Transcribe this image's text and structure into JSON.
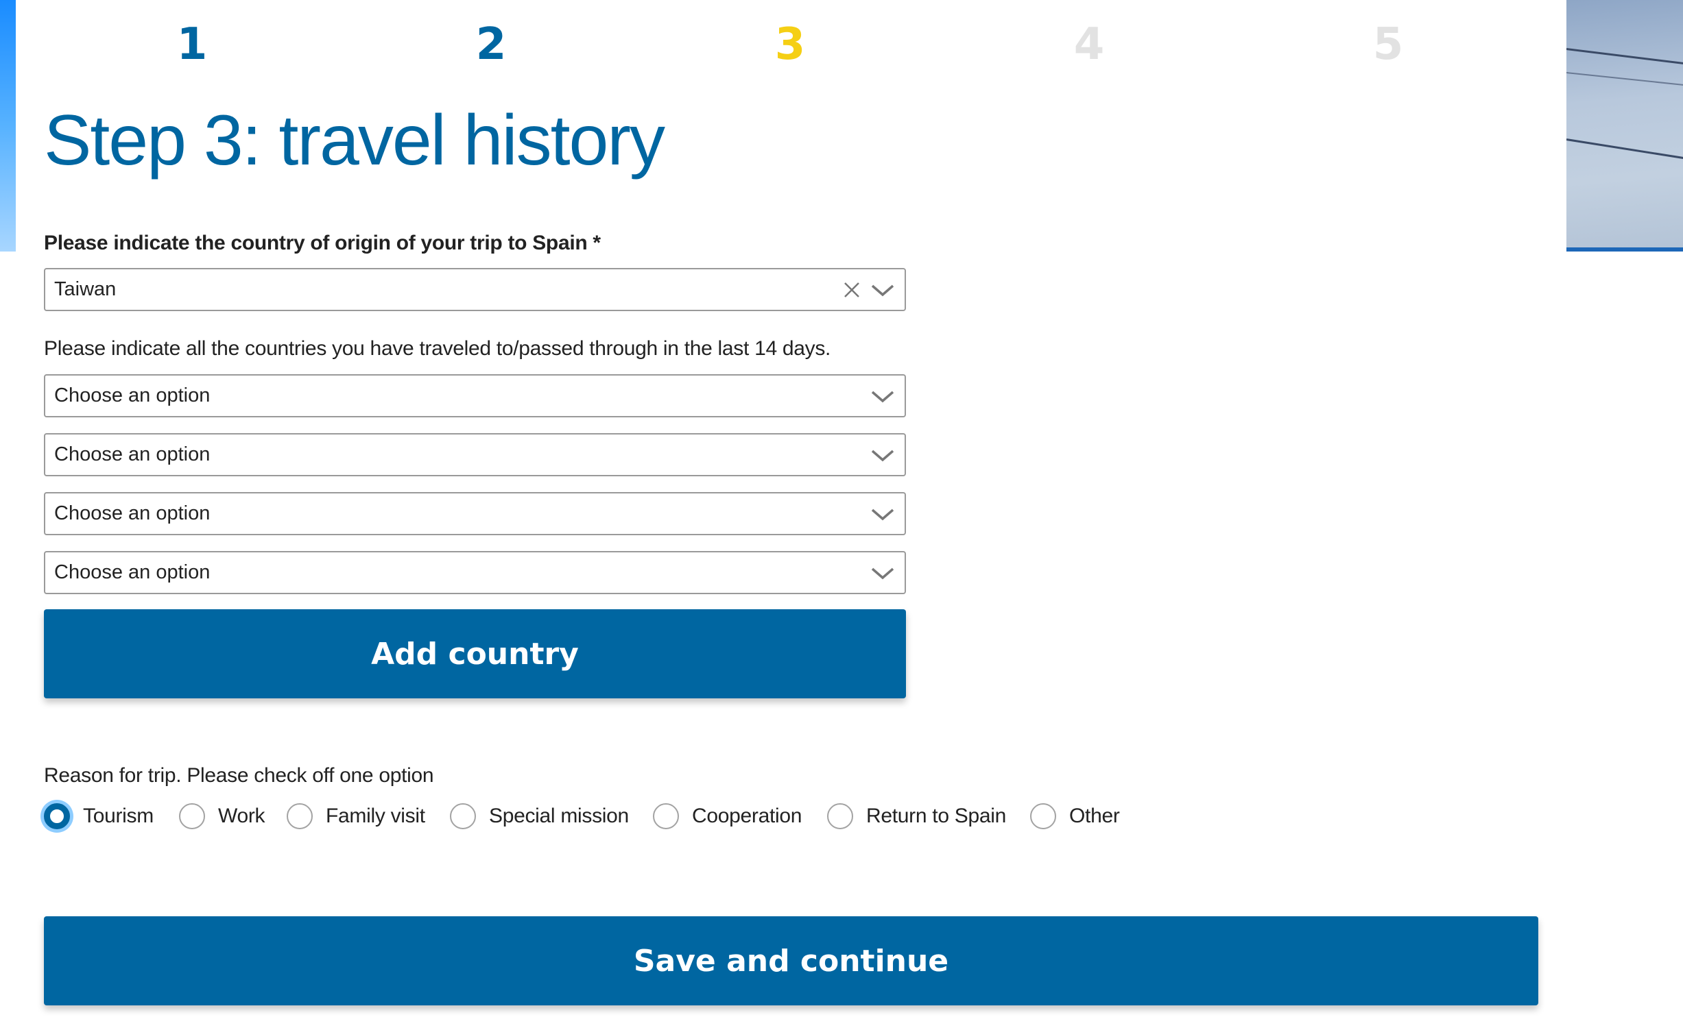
{
  "progress": {
    "steps": [
      {
        "number": "1",
        "state": "done"
      },
      {
        "number": "2",
        "state": "done"
      },
      {
        "number": "3",
        "state": "current"
      },
      {
        "number": "4",
        "state": "todo"
      },
      {
        "number": "5",
        "state": "todo"
      }
    ],
    "current_step": 3,
    "total_steps": 5
  },
  "page": {
    "title": "Step 3: travel history"
  },
  "origin": {
    "label": "Please indicate the country of origin of your trip to Spain *",
    "value": "Taiwan",
    "clear_icon": "close-icon",
    "dropdown_icon": "chevron-down-icon"
  },
  "transit": {
    "label": "Please indicate all the countries you have traveled to/passed through in the last 14 days.",
    "selects": [
      {
        "placeholder": "Choose an option"
      },
      {
        "placeholder": "Choose an option"
      },
      {
        "placeholder": "Choose an option"
      },
      {
        "placeholder": "Choose an option"
      }
    ],
    "add_button": "Add country"
  },
  "reason": {
    "label": "Reason for trip. Please check off one option",
    "options": [
      {
        "label": "Tourism",
        "checked": true
      },
      {
        "label": "Work",
        "checked": false
      },
      {
        "label": "Family visit",
        "checked": false
      },
      {
        "label": "Special mission",
        "checked": false
      },
      {
        "label": "Cooperation",
        "checked": false
      },
      {
        "label": "Return to Spain",
        "checked": false
      },
      {
        "label": "Other",
        "checked": false
      }
    ]
  },
  "actions": {
    "save_button": "Save and continue"
  },
  "colors": {
    "primary": "#0066a1",
    "current_step": "#f5cf14",
    "pending_step": "#e2e2e2",
    "focus_ring": "#8ecdff"
  }
}
